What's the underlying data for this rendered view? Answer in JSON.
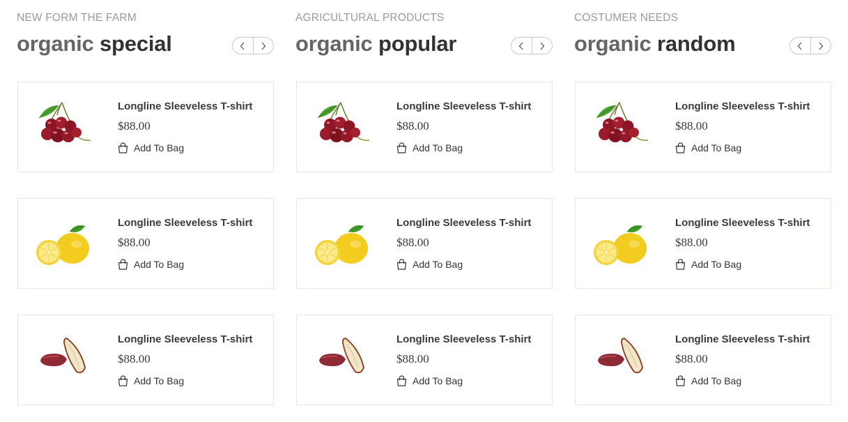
{
  "columns": [
    {
      "subtitle": "NEW FORM THE FARM",
      "title_light": "organic",
      "title_bold": "special",
      "products": [
        {
          "image": "cherry",
          "name": "Longline Sleeveless T-shirt",
          "price": "$88.00",
          "cta": "Add To Bag"
        },
        {
          "image": "lemon",
          "name": "Longline Sleeveless T-shirt",
          "price": "$88.00",
          "cta": "Add To Bag"
        },
        {
          "image": "date",
          "name": "Longline Sleeveless T-shirt",
          "price": "$88.00",
          "cta": "Add To Bag"
        }
      ]
    },
    {
      "subtitle": "AGRICULTURAL PRODUCTS",
      "title_light": "organic",
      "title_bold": "popular",
      "products": [
        {
          "image": "cherry",
          "name": "Longline Sleeveless T-shirt",
          "price": "$88.00",
          "cta": "Add To Bag"
        },
        {
          "image": "lemon",
          "name": "Longline Sleeveless T-shirt",
          "price": "$88.00",
          "cta": "Add To Bag"
        },
        {
          "image": "date",
          "name": "Longline Sleeveless T-shirt",
          "price": "$88.00",
          "cta": "Add To Bag"
        }
      ]
    },
    {
      "subtitle": "COSTUMER NEEDS",
      "title_light": "organic",
      "title_bold": "random",
      "products": [
        {
          "image": "cherry",
          "name": "Longline Sleeveless T-shirt",
          "price": "$88.00",
          "cta": "Add To Bag"
        },
        {
          "image": "lemon",
          "name": "Longline Sleeveless T-shirt",
          "price": "$88.00",
          "cta": "Add To Bag"
        },
        {
          "image": "date",
          "name": "Longline Sleeveless T-shirt",
          "price": "$88.00",
          "cta": "Add To Bag"
        }
      ]
    }
  ],
  "icons": {
    "prev": "chevron-left-icon",
    "next": "chevron-right-icon",
    "bag": "shopping-bag-icon"
  },
  "colors": {
    "title_light": "#666666",
    "title_bold": "#333333",
    "subtitle": "#9a9a9a",
    "card_border": "#ece4d8",
    "cherry": "#9b1b2a",
    "lemon": "#f2cc1f",
    "leaf": "#3f9a2a",
    "date": "#8e2a35"
  }
}
